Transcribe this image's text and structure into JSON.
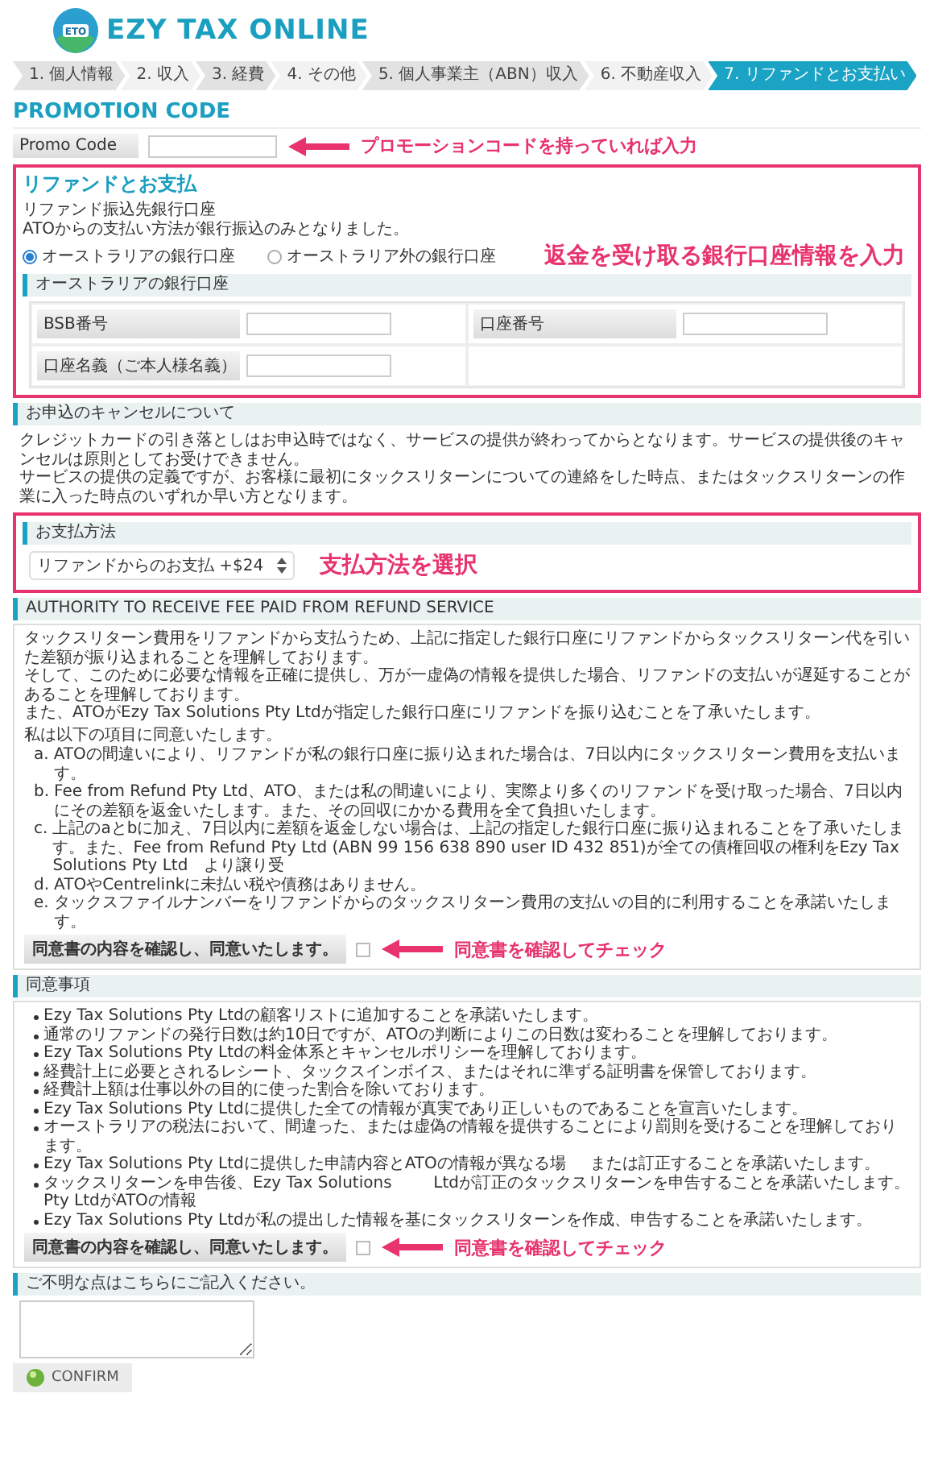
{
  "logo": {
    "badge": "ETO",
    "text": "EZY TAX ONLINE"
  },
  "steps": [
    {
      "label": "1. 個人情報",
      "selected": false
    },
    {
      "label": "2. 収入",
      "selected": false
    },
    {
      "label": "3. 経費",
      "selected": false
    },
    {
      "label": "4. その他",
      "selected": false
    },
    {
      "label": "5. 個人事業主（ABN）収入",
      "selected": false
    },
    {
      "label": "6. 不動産収入",
      "selected": false
    },
    {
      "label": "7. リファンドとお支払い",
      "selected": true
    }
  ],
  "promotion": {
    "title": "PROMOTION CODE",
    "label": "Promo Code",
    "note": "プロモーションコードを持っていれば入力"
  },
  "refund": {
    "title": "リファンドとお支払",
    "highlighted": true,
    "lines": [
      "リファンド振込先銀行口座",
      "ATOからの支払い方法が銀行振込のみとなりました。"
    ],
    "options": [
      {
        "label": "オーストラリアの銀行口座",
        "selected": true
      },
      {
        "label": "オーストラリア外の銀行口座",
        "selected": false
      }
    ],
    "note": "返金を受け取る銀行口座情報を入力",
    "bank": {
      "title": "オーストラリアの銀行口座",
      "fields": [
        {
          "label": "BSB番号"
        },
        {
          "label": "口座番号"
        },
        {
          "label": "口座名義（ご本人様名義）"
        }
      ]
    }
  },
  "cancel": {
    "title": "お申込のキャンセルについて",
    "lines": [
      "クレジットカードの引き落としはお申込時ではなく、サービスの提供が終わってからとなります。サービスの提供後のキャンセルは原則としてお受けできません。",
      "サービスの提供の定義ですが、お客様に最初にタックスリターンについての連絡をした時点、またはタックスリターンの作業に入った時点のいずれか早い方となります。"
    ]
  },
  "payment": {
    "title": "お支払方法",
    "highlighted": true,
    "value": "リファンドからのお支払 +$24",
    "note": "支払方法を選択"
  },
  "authority": {
    "title": "AUTHORITY TO RECEIVE FEE PAID FROM REFUND SERVICE",
    "paragraphs": [
      "タックスリターン費用をリファンドから支払うため、上記に指定した銀行口座にリファンドからタックスリターン代を引いた差額が振り込まれることを理解しております。",
      "そして、このために必要な情報を正確に提供し、万が一虚偽の情報を提供した場合、リファンドの支払いが遅延することがあることを理解しております。",
      "また、ATOがEzy Tax Solutions Pty Ltdが指定した銀行口座にリファンドを振り込むことを了承いたします。"
    ],
    "intro": "私は以下の項目に同意いたします。",
    "items": [
      {
        "marker": "a.",
        "text": "ATOの間違いにより、リファンドが私の銀行口座に振り込まれた場合は、7日以内にタックスリターン費用を支払います。"
      },
      {
        "marker": "b.",
        "text": "Fee from Refund Pty Ltd、ATO、または私の間違いにより、実際より多くのリファンドを受け取った場合、7日以内にその差額を返金いたします。また、その回収にかかる費用を全て負担いたします。"
      },
      {
        "marker": "c.",
        "text": "上記のaとbに加え、7日以内に差額を返金しない場合は、上記の指定した銀行口座に振り込まれることを了承いたします。また、Fee from Refund Pty Ltd (ABN 99 156 638 890 user ID 432 851)が全ての債権回収の権利をEzy Tax Solutions Pty Ltd　より譲り受"
      },
      {
        "marker": "d.",
        "text": "ATOやCentrelinkに未払い税や債務はありません。"
      },
      {
        "marker": "e.",
        "text": "タックスファイルナンバーをリファンドからのタックスリターン費用の支払いの目的に利用することを承諾いたします。"
      }
    ],
    "agree": {
      "label": "同意書の内容を確認し、同意いたします。",
      "checked": false
    },
    "note": "同意書を確認してチェック"
  },
  "consent": {
    "title": "同意事項",
    "items": [
      {
        "text": "Ezy Tax Solutions Pty Ltdの顧客リストに追加することを承諾いたします。"
      },
      {
        "text": "通常のリファンドの発行日数は約10日ですが、ATOの判断によりこの日数は変わることを理解しております。"
      },
      {
        "text": "Ezy Tax Solutions Pty Ltdの料金体系とキャンセルポリシーを理解しております。"
      },
      {
        "text": "経費計上に必要とされるレシート、タックスインボイス、またはそれに準ずる証明書を保管しております。"
      },
      {
        "text": "経費計上額は仕事以外の目的に使った割合を除いております。"
      },
      {
        "text": "Ezy Tax Solutions Pty Ltdに提供した全ての情報が真実であり正しいものであることを宣言いたします。"
      },
      {
        "text": "オーストラリアの税法において、間違った、または虚偽の情報を提供することにより罰則を受けることを理解しております。"
      },
      {
        "text": "Ezy Tax Solutions Pty Ltdに提供した申請内容とATOの情報が異なる場",
        "tail": "または訂正することを承諾いたします。"
      },
      {
        "text": "タックスリターンを申告後、Ezy Tax Solutions Pty LtdがATOの情報",
        "tail": "Ltdが訂正のタックスリターンを申告することを承諾いたします。"
      },
      {
        "text": "Ezy Tax Solutions Pty Ltdが私の提出した情報を基にタックスリターンを作成、申告することを承諾いたします。"
      }
    ],
    "agree": {
      "label": "同意書の内容を確認し、同意いたします。",
      "checked": false
    },
    "note": "同意書を確認してチェック"
  },
  "questions": {
    "title": "ご不明な点はこちらにご記入ください。"
  },
  "confirm": {
    "label": "CONFIRM"
  }
}
